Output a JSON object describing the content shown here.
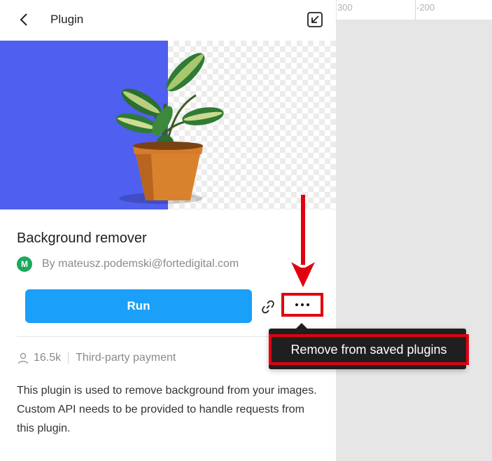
{
  "header": {
    "title": "Plugin"
  },
  "ruler": {
    "labels": [
      "300",
      "-200"
    ]
  },
  "plugin": {
    "name": "Background remover",
    "avatar_letter": "M",
    "author": "By mateusz.podemski@fortedigital.com",
    "run_label": "Run",
    "users": "16.5k",
    "payment": "Third-party payment",
    "description": "This plugin is used to remove background from your images. Custom API needs to be provided to handle requests from this plugin."
  },
  "menu": {
    "remove_label": "Remove from saved plugins"
  },
  "colors": {
    "accent": "#1aa0f8",
    "hero_blue": "#4f5ff0",
    "annotation_red": "#e0000f",
    "avatar_green": "#1ba85a"
  },
  "icons": [
    "chevron-left-icon",
    "collapse-icon",
    "link-icon",
    "more-icon",
    "user-icon"
  ]
}
